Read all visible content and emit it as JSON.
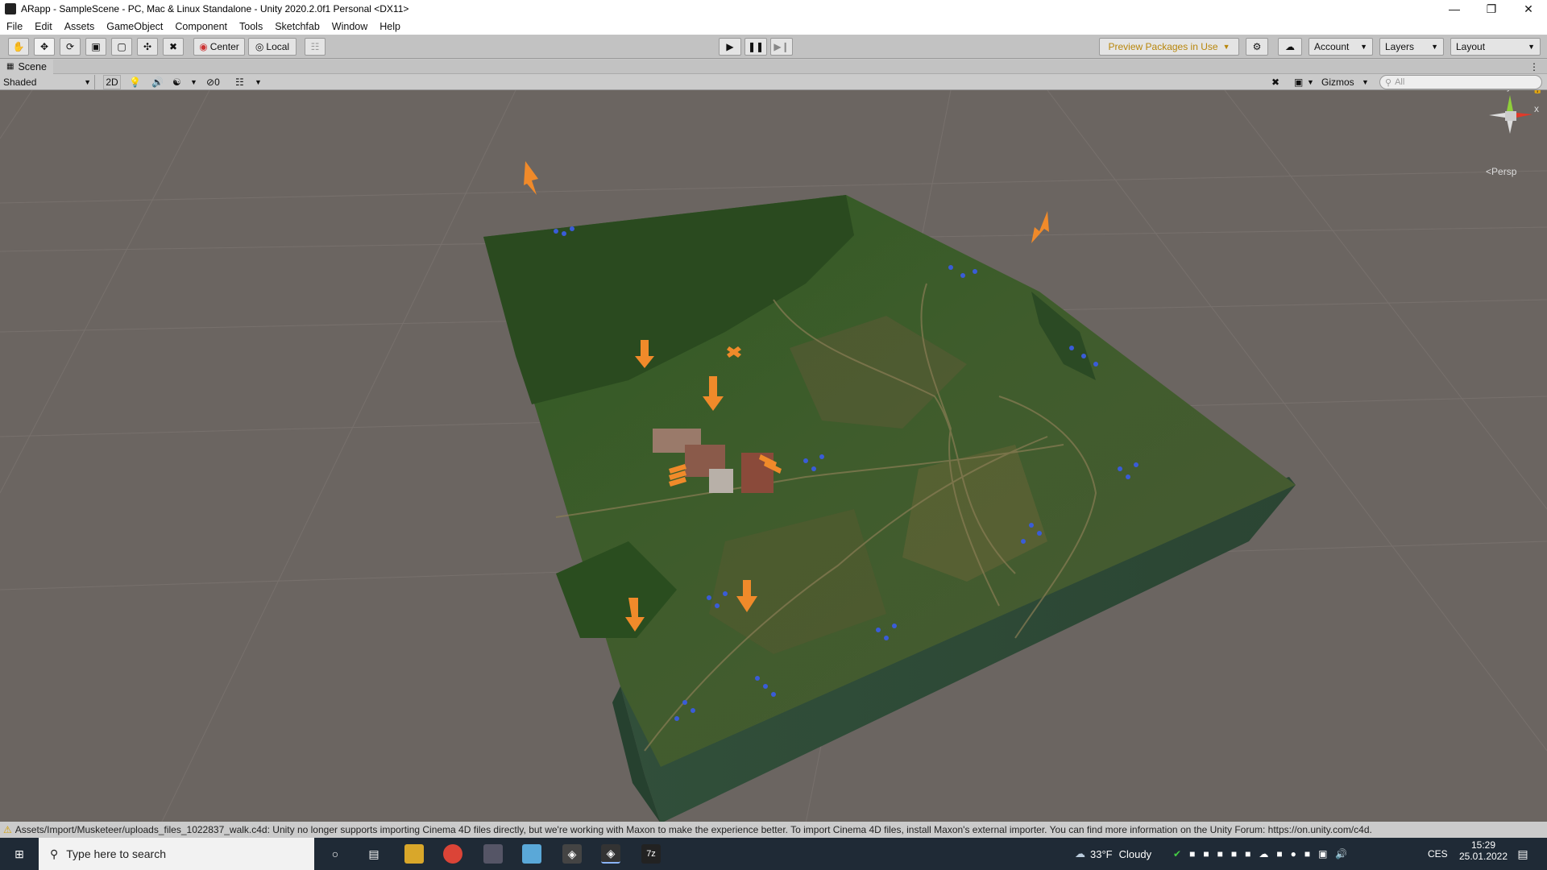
{
  "window": {
    "title": "ARapp - SampleScene - PC, Mac & Linux Standalone - Unity 2020.2.0f1 Personal <DX11>"
  },
  "menu": [
    "File",
    "Edit",
    "Assets",
    "GameObject",
    "Component",
    "Tools",
    "Sketchfab",
    "Window",
    "Help"
  ],
  "toolbar": {
    "pivot_label": "Center",
    "space_label": "Local",
    "preview_packages_label": "Preview Packages in Use",
    "account_label": "Account",
    "layers_label": "Layers",
    "layout_label": "Layout"
  },
  "scene": {
    "tab_label": "Scene",
    "shading_mode": "Shaded",
    "mode_2d": "2D",
    "hidden_count": "0",
    "gizmos_label": "Gizmos",
    "search_placeholder": "All",
    "persp_label": "Persp",
    "axis_y": "y",
    "axis_x": "x"
  },
  "status": {
    "message": "Assets/Import/Musketeer/uploads_files_1022837_walk.c4d: Unity no longer supports importing Cinema 4D files directly, but we're working with Maxon to make the experience better. To import Cinema 4D files, install Maxon's external importer. You can find more information on the Unity Forum: https://on.unity.com/c4d."
  },
  "taskbar": {
    "search_placeholder": "Type here to search",
    "weather_temp": "33°F",
    "weather_desc": "Cloudy",
    "language": "CES",
    "time": "15:29",
    "date": "25.01.2022"
  },
  "colors": {
    "viewport_bg": "#6b6561",
    "terrain_dark": "#2f4a2a",
    "terrain_side": "#2e4a36",
    "marker": "#f08a2a",
    "flowers": "#3a5cd8"
  }
}
